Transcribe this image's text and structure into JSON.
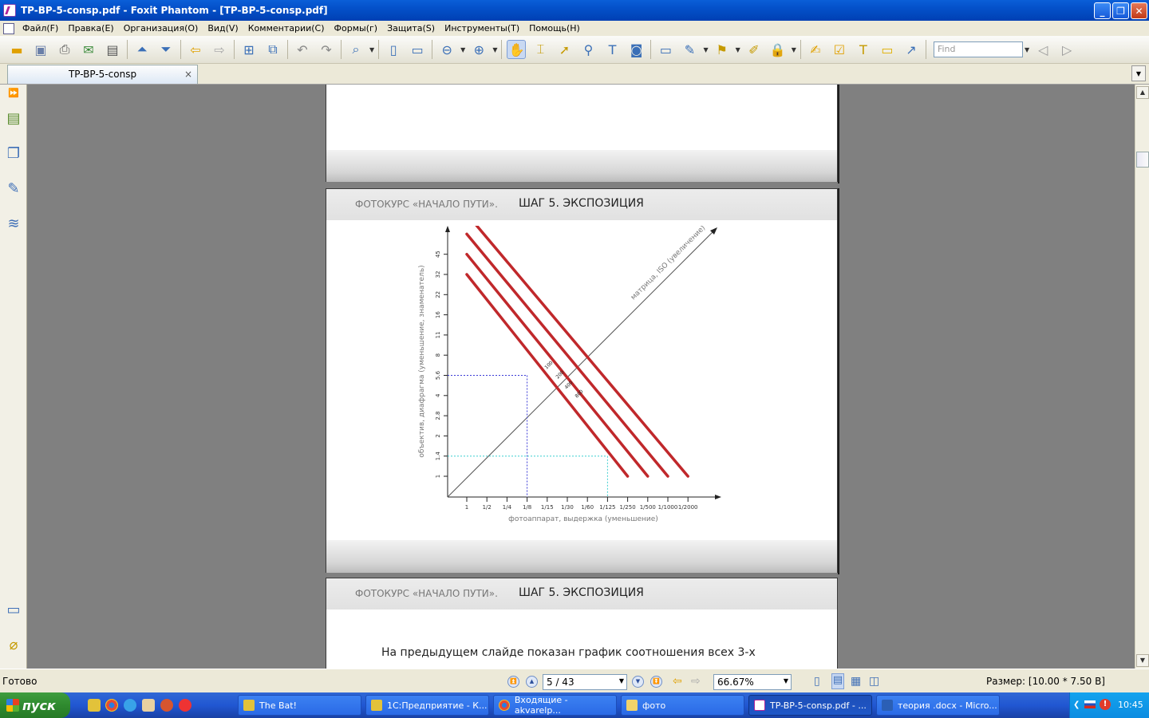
{
  "window": {
    "title": "TP-BP-5-consp.pdf - Foxit Phantom - [TP-BP-5-consp.pdf]"
  },
  "menu": [
    "Файл(F)",
    "Правка(E)",
    "Организация(O)",
    "Вид(V)",
    "Комментарии(C)",
    "Формы(г)",
    "Защита(S)",
    "Инструменты(T)",
    "Помощь(H)"
  ],
  "toolbar": {
    "find_placeholder": "Find"
  },
  "tab": {
    "label": "TP-BP-5-consp"
  },
  "pages": {
    "header_left": "ФОТОКУРС «НАЧАЛО ПУТИ».",
    "header_right": "ШАГ 5.  ЭКСПОЗИЦИЯ",
    "page3_text": "На предыдущем слайде показан  график соотношения всех 3-х"
  },
  "chart_data": {
    "type": "line",
    "xlabel": "фотоаппарат, выдержка (уменьшение)",
    "ylabel": "объектив, диафрагма (уменьшение, знаменатель)",
    "diag_label": "матрица, ISO (увеличение)",
    "x_ticks": [
      "1",
      "1/2",
      "1/4",
      "1/8",
      "1/15",
      "1/30",
      "1/60",
      "1/125",
      "1/250",
      "1/500",
      "1/1000",
      "1/2000"
    ],
    "y_ticks": [
      "1",
      "1.4",
      "2",
      "2.8",
      "4",
      "5.6",
      "8",
      "11",
      "16",
      "22",
      "32",
      "45"
    ],
    "series": [
      {
        "name": "100",
        "start": [
          1,
          11
        ],
        "end": [
          9,
          1
        ],
        "color": "#c0282b"
      },
      {
        "name": "200",
        "start": [
          1,
          12
        ],
        "end": [
          10,
          1
        ],
        "color": "#c0282b"
      },
      {
        "name": "400",
        "start": [
          1,
          13
        ],
        "end": [
          11,
          1
        ],
        "color": "#c0282b"
      },
      {
        "name": "800",
        "start": [
          1,
          14
        ],
        "end": [
          12,
          1
        ],
        "color": "#c0282b"
      }
    ],
    "guides": [
      {
        "x": "1/8",
        "y": "5.6",
        "color": "#3b3bd6"
      },
      {
        "x": "1/125",
        "y": "1.4",
        "color": "#3ccfd0"
      }
    ],
    "grid": false
  },
  "status": {
    "ready": "Готово",
    "page": "5 / 43",
    "zoom": "66.67%",
    "size": "Размер: [10.00 * 7.50 В]"
  },
  "taskbar": {
    "start": "пуск",
    "tasks": [
      "The Bat!",
      "1С:Предприятие - К...",
      "Входящие - akvarelp...",
      "фото",
      "TP-BP-5-consp.pdf - ...",
      "теория .docx - Micro..."
    ],
    "clock": "10:45"
  }
}
